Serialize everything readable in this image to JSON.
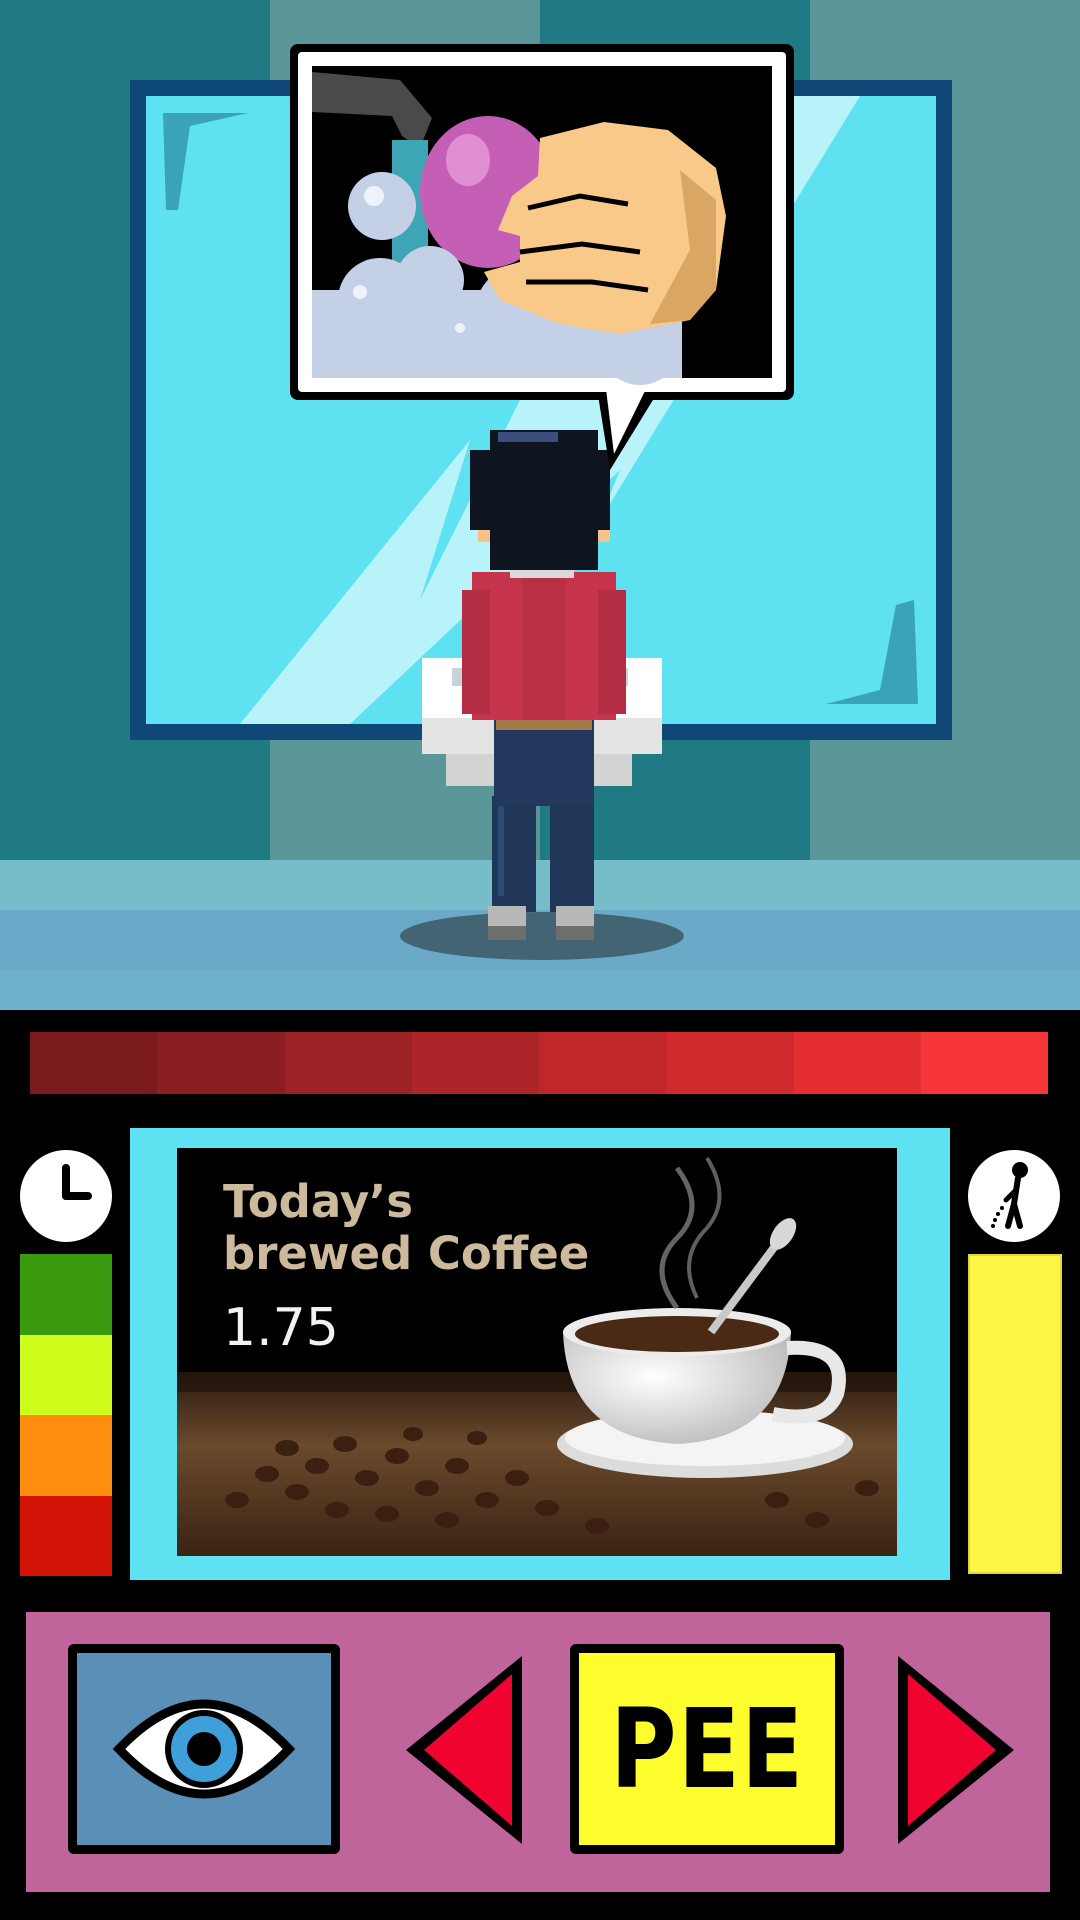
{
  "colors": {
    "wall_dark": "#1f7a84",
    "wall_mid": "#5b9699",
    "mirror": "#5ee2f2",
    "mirror_frame": "#0f4876",
    "floor_top": "#76bcc9",
    "floor": "#6fb0cc",
    "urine_meter": [
      "#7a1a1c",
      "#8b1e22",
      "#9c2226",
      "#ad2429",
      "#bf272b",
      "#d12a2e",
      "#e42e31",
      "#f7363a"
    ],
    "patience_bar": [
      "#3a9a0f",
      "#cefd1c",
      "#ff8e0e",
      "#d21406"
    ],
    "pee_level": "#fff546",
    "controls_bg": "#c0649c",
    "look_button": "#5a8fb8",
    "pee_button": "#fdfd2d",
    "arrow": "#f0042f"
  },
  "speech_bubble": {
    "icon": "hand-washing-icon"
  },
  "advertisement": {
    "title": "Today’s\nbrewed Coffee",
    "price": "1.75",
    "image": "coffee-cup-and-beans"
  },
  "hud": {
    "timer_icon": "clock-icon",
    "pee_icon": "peeing-person-icon",
    "patience_levels": 4,
    "pee_level_fraction": 1.0
  },
  "controls": {
    "look_icon": "eye-icon",
    "prev_icon": "arrow-left-icon",
    "pee_label": "PEE",
    "next_icon": "arrow-right-icon"
  }
}
